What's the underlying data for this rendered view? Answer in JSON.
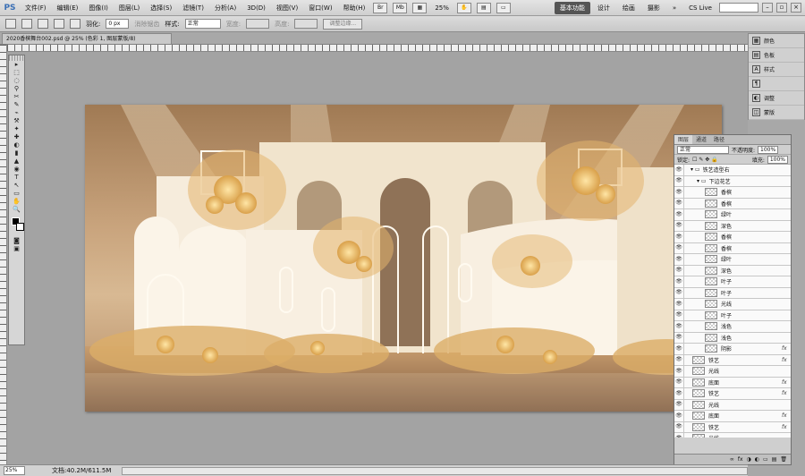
{
  "app": {
    "logo": "PS"
  },
  "menu": [
    "文件(F)",
    "编辑(E)",
    "图像(I)",
    "图层(L)",
    "选择(S)",
    "滤镜(T)",
    "分析(A)",
    "3D(D)",
    "视图(V)",
    "窗口(W)",
    "帮助(H)"
  ],
  "menubar": {
    "br_icon": "Br",
    "mb_icon": "Mb",
    "zoom": "25%"
  },
  "workspaces": {
    "active": "基本功能",
    "items": [
      "设计",
      "绘画",
      "摄影"
    ],
    "more": "»"
  },
  "cslive": "CS Live",
  "options": {
    "feather_label": "羽化:",
    "feather_value": "0 px",
    "antialias_label": "消除锯齿",
    "style_label": "样式:",
    "style_value": "正常",
    "width_label": "宽度:",
    "height_label": "高度:",
    "refine_button": "调整边缘..."
  },
  "document": {
    "tab_title": "2020香槟舞台002.psd @ 25% (色彩 1, 图层蒙版/8)"
  },
  "tools": [
    "▸",
    "⬚",
    "◌",
    "⚲",
    "✂",
    "✎",
    "⌁",
    "⚒",
    "✦",
    "✚",
    "◐",
    "▮",
    "▲",
    "◉",
    "T",
    "↖",
    "▭",
    "✋",
    "🔍"
  ],
  "dock": [
    {
      "icon": "▦",
      "label": "颜色"
    },
    {
      "icon": "▤",
      "label": "色板"
    },
    {
      "icon": "A",
      "label": "样式"
    },
    {
      "icon": "¶",
      "label": ""
    },
    {
      "icon": "◐",
      "label": "调整"
    },
    {
      "icon": "◫",
      "label": "蒙版"
    }
  ],
  "layers_panel": {
    "tabs": [
      "图层",
      "通道",
      "路径"
    ],
    "blend_mode": "正常",
    "opacity_label": "不透明度:",
    "opacity_value": "100%",
    "lock_label": "锁定:",
    "fill_label": "填充:",
    "fill_value": "100%",
    "rows": [
      {
        "indent": 1,
        "group": true,
        "name": "铁艺造型右",
        "fx": ""
      },
      {
        "indent": 2,
        "group": true,
        "name": "下边花艺",
        "fx": ""
      },
      {
        "indent": 3,
        "group": false,
        "name": "香槟",
        "fx": ""
      },
      {
        "indent": 3,
        "group": false,
        "name": "香槟",
        "fx": ""
      },
      {
        "indent": 3,
        "group": false,
        "name": "绿叶",
        "fx": ""
      },
      {
        "indent": 3,
        "group": false,
        "name": "深色",
        "fx": ""
      },
      {
        "indent": 3,
        "group": false,
        "name": "香槟",
        "fx": ""
      },
      {
        "indent": 3,
        "group": false,
        "name": "香槟",
        "fx": ""
      },
      {
        "indent": 3,
        "group": false,
        "name": "绿叶",
        "fx": ""
      },
      {
        "indent": 3,
        "group": false,
        "name": "深色",
        "fx": ""
      },
      {
        "indent": 3,
        "group": false,
        "name": "叶子",
        "fx": ""
      },
      {
        "indent": 3,
        "group": false,
        "name": "叶子",
        "fx": ""
      },
      {
        "indent": 3,
        "group": false,
        "name": "光线",
        "fx": ""
      },
      {
        "indent": 3,
        "group": false,
        "name": "叶子",
        "fx": ""
      },
      {
        "indent": 3,
        "group": false,
        "name": "浅色",
        "fx": ""
      },
      {
        "indent": 3,
        "group": false,
        "name": "浅色",
        "fx": ""
      },
      {
        "indent": 3,
        "group": false,
        "name": "阴影",
        "fx": "fx"
      },
      {
        "indent": 1,
        "group": false,
        "name": "铁艺",
        "fx": "fx"
      },
      {
        "indent": 1,
        "group": false,
        "name": "光线",
        "fx": ""
      },
      {
        "indent": 1,
        "group": false,
        "name": "底面",
        "fx": "fx"
      },
      {
        "indent": 1,
        "group": false,
        "name": "铁艺",
        "fx": "fx"
      },
      {
        "indent": 1,
        "group": false,
        "name": "光线",
        "fx": ""
      },
      {
        "indent": 1,
        "group": false,
        "name": "底面",
        "fx": "fx"
      },
      {
        "indent": 1,
        "group": false,
        "name": "铁艺",
        "fx": "fx"
      },
      {
        "indent": 1,
        "group": false,
        "name": "光线",
        "fx": ""
      },
      {
        "indent": 1,
        "group": false,
        "name": "底面",
        "fx": ""
      }
    ],
    "footer": [
      "∞",
      "fx",
      "◑",
      "◐",
      "▭",
      "▤",
      "🗑"
    ]
  },
  "status": {
    "zoom": "25%",
    "doc": "文档:40.2M/611.5M"
  },
  "colors": {
    "stage_light": "#f4ead9",
    "stage_gold": "#d9a55c",
    "stage_brown": "#9a7150"
  }
}
